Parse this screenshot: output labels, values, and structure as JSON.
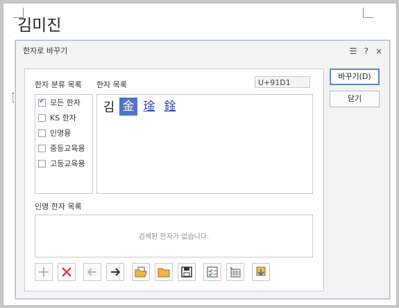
{
  "document": {
    "text": "김미진"
  },
  "dialog": {
    "title": "한자로 바꾸기",
    "controls": {
      "memo_icon": "☰",
      "help": "?",
      "close": "×"
    },
    "labels": {
      "category": "한자 분류 목록",
      "hanja_list": "한자 목록",
      "name_list": "인명 한자 목록"
    },
    "code": "U+91D1",
    "categories": [
      {
        "label": "모든 한자",
        "checked": true
      },
      {
        "label": "KS 한자",
        "checked": false
      },
      {
        "label": "인명용",
        "checked": false
      },
      {
        "label": "중등교육용",
        "checked": false
      },
      {
        "label": "고등교육용",
        "checked": false
      }
    ],
    "base_char": "김",
    "hanja": [
      "金",
      "琻",
      "鍂"
    ],
    "selected_hanja": 0,
    "empty_message": "검색된 한자가 없습니다.",
    "buttons": {
      "replace": "바꾸기(D)",
      "close": "닫기"
    },
    "toolbar_icons": [
      "plus-icon",
      "delete-icon",
      "arrow-left-icon",
      "arrow-right-icon",
      "open-folder-icon",
      "folder-icon",
      "save-icon",
      "checklist-icon",
      "grid-icon",
      "import-icon"
    ]
  }
}
